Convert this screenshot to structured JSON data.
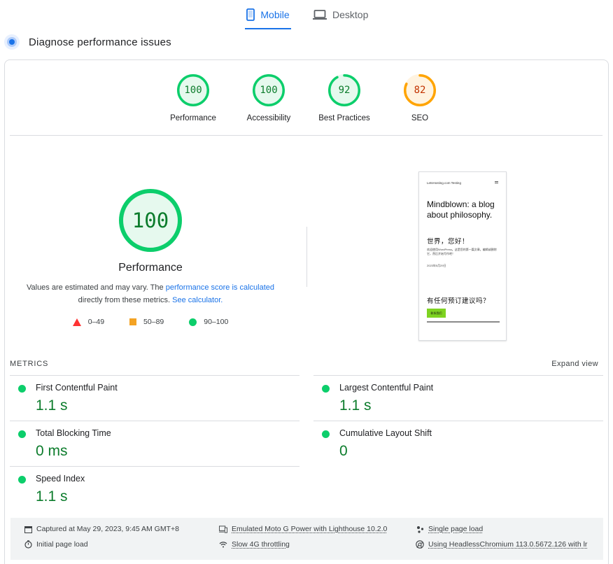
{
  "tabs": {
    "mobile": {
      "label": "Mobile",
      "icon": "smartphone-icon",
      "active": true
    },
    "desktop": {
      "label": "Desktop",
      "icon": "laptop-icon",
      "active": false
    }
  },
  "diagnose": {
    "title": "Diagnose performance issues",
    "icon": "diagnose-icon"
  },
  "scores": [
    {
      "label": "Performance",
      "value": "100",
      "fraction": 1.0,
      "color": "#0cce6b"
    },
    {
      "label": "Accessibility",
      "value": "100",
      "fraction": 1.0,
      "color": "#0cce6b"
    },
    {
      "label": "Best Practices",
      "value": "92",
      "fraction": 0.92,
      "color": "#0cce6b"
    },
    {
      "label": "SEO",
      "value": "82",
      "fraction": 0.82,
      "color": "#ffa400"
    }
  ],
  "performance": {
    "score": "100",
    "fraction": 1.0,
    "title": "Performance",
    "note_before": "Values are estimated and may vary. The ",
    "note_link1": "performance score is calculated",
    "note_middle": " directly from these metrics. ",
    "note_link2": "See calculator."
  },
  "legend": [
    {
      "shape": "triangle",
      "range": "0–49",
      "color": "#ff3333"
    },
    {
      "shape": "square",
      "range": "50–89",
      "color": "#ffa400"
    },
    {
      "shape": "circle",
      "range": "90–100",
      "color": "#0cce6b"
    }
  ],
  "thumbnail": {
    "site_name": "LetsHosting.com Testing",
    "heading": "Mindblown: a blog about philosophy.",
    "post_title": "世界，您好！",
    "post_excerpt": "欢迎使用WordPress。这是您的第一篇文章。编辑或删除它，然后开始写作吧！",
    "post_date": "2023年5月29日",
    "section_title": "有任何预订建议吗？",
    "button_label": "联系我们"
  },
  "metrics": {
    "heading": "METRICS",
    "expand_label": "Expand view",
    "left": [
      {
        "name": "First Contentful Paint",
        "value": "1.1 s"
      },
      {
        "name": "Total Blocking Time",
        "value": "0 ms"
      },
      {
        "name": "Speed Index",
        "value": "1.1 s"
      }
    ],
    "right": [
      {
        "name": "Largest Contentful Paint",
        "value": "1.1 s"
      },
      {
        "name": "Cumulative Layout Shift",
        "value": "0"
      }
    ]
  },
  "info": {
    "captured": "Captured at May 29, 2023, 9:45 AM GMT+8",
    "initial_load": "Initial page load",
    "device": "Emulated Moto G Power with Lighthouse 10.2.0",
    "throttling": "Slow 4G throttling",
    "session": "Single page load",
    "browser": "Using HeadlessChromium 113.0.5672.126 with lr"
  }
}
